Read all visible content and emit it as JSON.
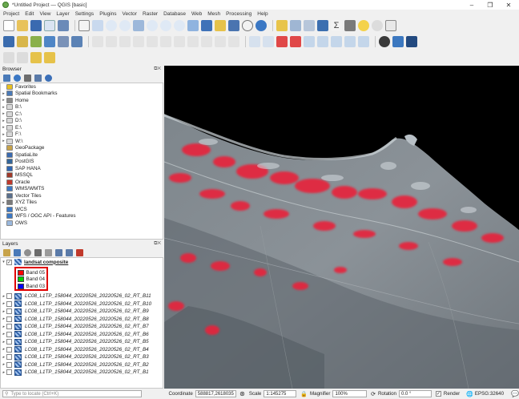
{
  "window": {
    "title": "*Untitled Project — QGIS [basic]",
    "minimize": "–",
    "maximize": "❐",
    "close": "✕"
  },
  "menu": [
    "Project",
    "Edit",
    "View",
    "Layer",
    "Settings",
    "Plugins",
    "Vector",
    "Raster",
    "Database",
    "Web",
    "Mesh",
    "Processing",
    "Help"
  ],
  "browser": {
    "title": "Browser",
    "items": [
      {
        "label": "Favorites",
        "icon": "star-icon",
        "color": "#e8c020",
        "arrow": ""
      },
      {
        "label": "Spatial Bookmarks",
        "icon": "bookmark-icon",
        "color": "#4a7ab8",
        "arrow": "▸"
      },
      {
        "label": "Home",
        "icon": "home-icon",
        "color": "#8a8a8a",
        "arrow": "▸"
      },
      {
        "label": "B:\\",
        "icon": "drive-icon",
        "color": "#d8d8d8",
        "arrow": "▸"
      },
      {
        "label": "C:\\",
        "icon": "drive-icon",
        "color": "#d8d8d8",
        "arrow": "▸"
      },
      {
        "label": "D:\\",
        "icon": "drive-icon",
        "color": "#d8d8d8",
        "arrow": "▸"
      },
      {
        "label": "E:\\",
        "icon": "drive-icon",
        "color": "#d8d8d8",
        "arrow": "▸"
      },
      {
        "label": "F:\\",
        "icon": "drive-icon",
        "color": "#d8d8d8",
        "arrow": "▸"
      },
      {
        "label": "W:\\",
        "icon": "drive-icon",
        "color": "#d8d8d8",
        "arrow": "▸"
      },
      {
        "label": "GeoPackage",
        "icon": "geopackage-icon",
        "color": "#c7a24a",
        "arrow": ""
      },
      {
        "label": "SpatiaLite",
        "icon": "spatialite-icon",
        "color": "#3a6ab0",
        "arrow": ""
      },
      {
        "label": "PostGIS",
        "icon": "postgis-icon",
        "color": "#33669a",
        "arrow": ""
      },
      {
        "label": "SAP HANA",
        "icon": "database-icon",
        "color": "#2f66b3",
        "arrow": ""
      },
      {
        "label": "MSSQL",
        "icon": "mssql-icon",
        "color": "#a03a2a",
        "arrow": ""
      },
      {
        "label": "Oracle",
        "icon": "oracle-icon",
        "color": "#c0392b",
        "arrow": ""
      },
      {
        "label": "WMS/WMTS",
        "icon": "globe-icon",
        "color": "#3b78c4",
        "arrow": ""
      },
      {
        "label": "Vector Tiles",
        "icon": "vector-tiles-icon",
        "color": "#5a6f8c",
        "arrow": ""
      },
      {
        "label": "XYZ Tiles",
        "icon": "grid-icon",
        "color": "#7a7a7a",
        "arrow": "▸"
      },
      {
        "label": "WCS",
        "icon": "globe-icon",
        "color": "#3b78c4",
        "arrow": ""
      },
      {
        "label": "WFS / OGC API - Features",
        "icon": "globe-icon",
        "color": "#3b78c4",
        "arrow": ""
      },
      {
        "label": "OWS",
        "icon": "globe-icon",
        "color": "#9ab8de",
        "arrow": ""
      }
    ]
  },
  "layers": {
    "title": "Layers",
    "group": {
      "label": "landsat composite",
      "checked": "✓",
      "arrow": "▾"
    },
    "bands": [
      {
        "label": "Band 05",
        "color": "#ff0000"
      },
      {
        "label": "Band 04",
        "color": "#00d000"
      },
      {
        "label": "Band 03",
        "color": "#0000ff"
      }
    ],
    "rasters": [
      "LC08_L1TP_158044_20220526_20220526_02_RT_B11",
      "LC08_L1TP_158044_20220526_20220526_02_RT_B10",
      "LC08_L1TP_158044_20220526_20220526_02_RT_B9",
      "LC08_L1TP_158044_20220526_20220526_02_RT_B8",
      "LC08_L1TP_158044_20220526_20220526_02_RT_B7",
      "LC08_L1TP_158044_20220526_20220526_02_RT_B6",
      "LC08_L1TP_158044_20220526_20220526_02_RT_B5",
      "LC08_L1TP_158044_20220526_20220526_02_RT_B4",
      "LC08_L1TP_158044_20220526_20220526_02_RT_B3",
      "LC08_L1TP_158044_20220526_20220526_02_RT_B2",
      "LC08_L1TP_158044_20220526_20220526_02_RT_B1"
    ]
  },
  "status": {
    "locate_placeholder": "Type to locate (Ctrl+K)",
    "coordinate_label": "Coordinate",
    "coordinate_value": "588817,2618035",
    "scale_label": "Scale",
    "scale_value": "1:145275",
    "magnifier_label": "Magnifier",
    "magnifier_value": "100%",
    "rotation_label": "Rotation",
    "rotation_value": "0.0 °",
    "render_label": "Render",
    "render_checked": "✓",
    "crs": "EPSG:32640"
  },
  "colors": {
    "map_background": "#000000",
    "land": "#8a9096",
    "vegetation": "#e8203a",
    "highlight_box": "#e00000"
  }
}
